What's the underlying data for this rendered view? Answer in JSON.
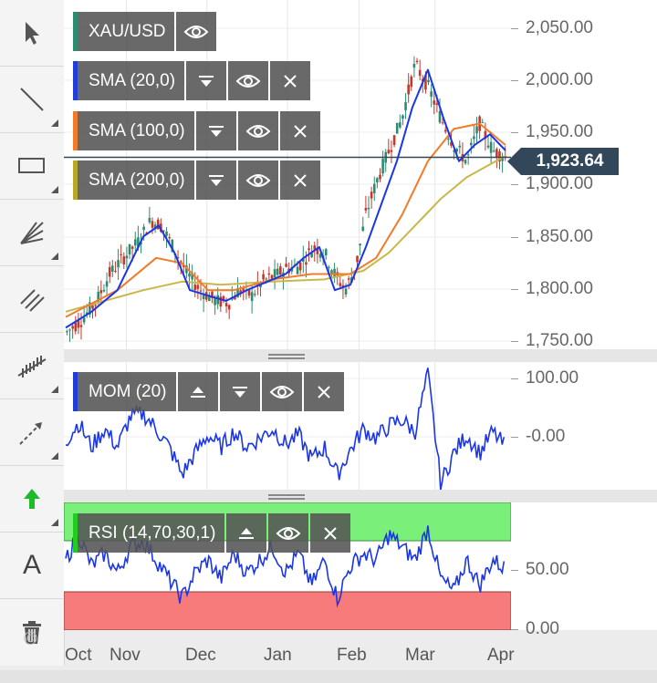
{
  "toolbar": {
    "tools": [
      {
        "icon": "pointer-icon"
      },
      {
        "icon": "line-icon"
      },
      {
        "icon": "rectangle-icon"
      },
      {
        "icon": "fan-icon"
      },
      {
        "icon": "parallel-channel-icon"
      },
      {
        "icon": "pitchfork-icon"
      },
      {
        "icon": "arrow-line-icon"
      },
      {
        "icon": "up-arrow-icon"
      },
      {
        "icon": "text-icon",
        "label": "A"
      },
      {
        "icon": "trash-icon"
      }
    ],
    "watermark": "©"
  },
  "legends": {
    "main": [
      {
        "name": "XAU/USD",
        "color": "#2e8b6f"
      },
      {
        "name": "SMA (20,0)",
        "color": "#1f3fd8"
      },
      {
        "name": "SMA (100,0)",
        "color": "#f07c2a"
      },
      {
        "name": "SMA (200,0)",
        "color": "#b8a82a"
      }
    ],
    "mom": {
      "name": "MOM (20)",
      "color": "#1f3fd8"
    },
    "rsi": {
      "name": "RSI (14,70,30,1)",
      "color": "#22cc22"
    }
  },
  "current_price": "1,923.64",
  "colors": {
    "candle_up": "#2e8b6f",
    "candle_down": "#c0392b",
    "line_blue": "#1a36e6",
    "sma100": "#f07c2a",
    "sma200": "#c8b84a",
    "price_line": "#33475b",
    "rsi_overbought": "#7af07a",
    "rsi_oversold": "#f77b7b"
  },
  "chart_data": [
    {
      "type": "line",
      "title": "XAU/USD",
      "x_labels": [
        "Oct",
        "Nov",
        "Dec",
        "Jan",
        "Feb",
        "Mar",
        "Apr"
      ],
      "yticks": [
        "2,050.00",
        "2,000.00",
        "1,950.00",
        "1,900.00",
        "1,850.00",
        "1,800.00",
        "1,750.00"
      ],
      "ylim": [
        1745,
        2070
      ],
      "series": [
        {
          "name": "XAU/USD",
          "x": [
            0,
            6,
            12,
            17,
            23,
            28,
            33,
            37,
            42,
            47,
            52,
            58,
            63,
            67,
            72,
            76,
            82,
            85,
            90,
            96,
            100,
            104,
            108,
            112,
            116,
            120,
            125,
            130,
            135,
            140,
            145,
            150,
            155,
            160,
            165,
            170
          ],
          "values": [
            1760,
            1772,
            1790,
            1815,
            1832,
            1845,
            1865,
            1860,
            1838,
            1815,
            1800,
            1790,
            1788,
            1800,
            1795,
            1808,
            1815,
            1820,
            1822,
            1840,
            1835,
            1815,
            1800,
            1820,
            1870,
            1900,
            1930,
            1960,
            2010,
            1990,
            1960,
            1935,
            1920,
            1955,
            1930,
            1924
          ]
        },
        {
          "name": "SMA (20,0)",
          "x": [
            0,
            10,
            20,
            30,
            36,
            42,
            48,
            55,
            62,
            70,
            78,
            85,
            92,
            98,
            104,
            110,
            116,
            122,
            128,
            134,
            140,
            146,
            152,
            158,
            164,
            170
          ],
          "values": [
            1765,
            1780,
            1800,
            1850,
            1860,
            1835,
            1800,
            1795,
            1790,
            1800,
            1808,
            1815,
            1830,
            1840,
            1800,
            1805,
            1840,
            1880,
            1920,
            1970,
            2005,
            1960,
            1920,
            1935,
            1945,
            1930
          ]
        },
        {
          "name": "SMA (100,0)",
          "x": [
            0,
            20,
            35,
            45,
            55,
            65,
            80,
            95,
            110,
            120,
            130,
            140,
            150,
            160,
            170
          ],
          "values": [
            1775,
            1800,
            1830,
            1825,
            1800,
            1800,
            1810,
            1815,
            1815,
            1830,
            1870,
            1920,
            1950,
            1955,
            1935
          ]
        },
        {
          "name": "SMA (200,0)",
          "x": [
            0,
            30,
            45,
            60,
            80,
            100,
            115,
            125,
            135,
            145,
            155,
            170
          ],
          "values": [
            1780,
            1800,
            1808,
            1805,
            1808,
            1810,
            1818,
            1835,
            1860,
            1885,
            1905,
            1925
          ]
        }
      ]
    },
    {
      "type": "line",
      "title": "MOM (20)",
      "yticks": [
        "100.00",
        "-0.00"
      ],
      "ylim": [
        -80,
        130
      ],
      "series": [
        {
          "name": "MOM (20)",
          "x": [
            0,
            5,
            10,
            15,
            20,
            25,
            30,
            35,
            40,
            45,
            50,
            55,
            60,
            65,
            70,
            75,
            80,
            85,
            90,
            95,
            100,
            105,
            110,
            115,
            120,
            125,
            130,
            135,
            140,
            145,
            150,
            155,
            160,
            165,
            170
          ],
          "values": [
            0,
            30,
            -10,
            20,
            -10,
            40,
            45,
            20,
            -10,
            -55,
            -20,
            10,
            -10,
            15,
            -10,
            5,
            20,
            -5,
            10,
            -30,
            -10,
            -55,
            -15,
            20,
            5,
            25,
            35,
            15,
            110,
            -70,
            -20,
            10,
            -20,
            15,
            -10
          ]
        }
      ]
    },
    {
      "type": "line",
      "title": "RSI (14,70,30,1)",
      "yticks": [
        "50.00",
        "0.00"
      ],
      "ylim": [
        0,
        100
      ],
      "bands": {
        "overbought": 70,
        "oversold": 30
      },
      "series": [
        {
          "name": "RSI (14,70,30,1)",
          "x": [
            0,
            5,
            10,
            15,
            20,
            25,
            30,
            35,
            40,
            45,
            50,
            55,
            60,
            65,
            70,
            75,
            80,
            85,
            90,
            95,
            100,
            105,
            110,
            115,
            120,
            125,
            130,
            135,
            140,
            145,
            150,
            155,
            160,
            165,
            170
          ],
          "values": [
            55,
            75,
            50,
            60,
            45,
            65,
            70,
            55,
            40,
            25,
            45,
            55,
            40,
            60,
            45,
            55,
            65,
            45,
            60,
            35,
            55,
            25,
            50,
            60,
            55,
            75,
            65,
            55,
            80,
            40,
            30,
            55,
            35,
            55,
            48
          ]
        }
      ]
    }
  ]
}
